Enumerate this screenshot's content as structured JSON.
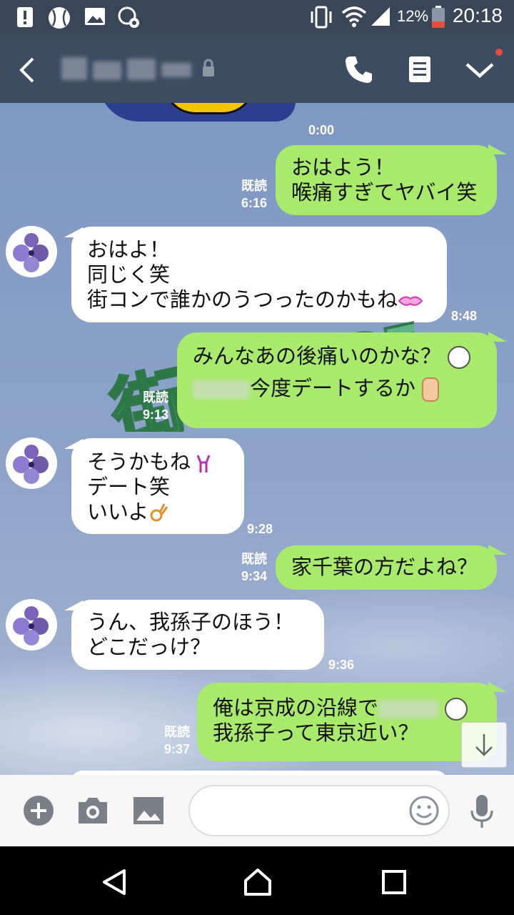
{
  "status_bar": {
    "battery_percent": "12%",
    "time": "20:18",
    "icons": [
      "alert-icon",
      "baseball-icon",
      "image-icon",
      "settings-sync-icon",
      "vibrate-icon",
      "wifi-icon",
      "signal-icon",
      "battery-icon"
    ]
  },
  "header": {
    "icons": [
      "back-icon",
      "lock-icon",
      "phone-icon",
      "notes-icon",
      "chevron-down-icon"
    ],
    "notification_color": "#e74c3c"
  },
  "chat": {
    "top_time": "0:00",
    "messages": [
      {
        "side": "me",
        "lines": [
          "おはよう！",
          "喉痛すぎてヤバイ笑"
        ],
        "read": "既読",
        "time": "6:16"
      },
      {
        "side": "them",
        "lines": [
          "おはよ！",
          "同じく笑",
          "街コンで誰かのうつったのかもね"
        ],
        "time": "8:48"
      },
      {
        "side": "me",
        "lines": [
          "みんなあの後痛いのかな？",
          "今度デートするか"
        ],
        "read": "既読",
        "time": "9:13"
      },
      {
        "side": "them",
        "lines": [
          "そうかもね",
          "デート笑",
          "いいよ"
        ],
        "time": "9:28"
      },
      {
        "side": "me",
        "lines": [
          "家千葉の方だよね？"
        ],
        "read": "既読",
        "time": "9:34"
      },
      {
        "side": "them",
        "lines": [
          "うん、我孫子のほう！",
          "どこだっけ？"
        ],
        "time": "9:36"
      },
      {
        "side": "me",
        "lines": [
          "俺は京成の沿線で",
          "我孫子って東京近い？"
        ],
        "read": "既読",
        "time": "9:37"
      }
    ],
    "watermark": "街コンCEO"
  },
  "input_bar": {
    "icons": [
      "add-icon",
      "camera-icon",
      "image-icon",
      "emoji-icon",
      "mic-icon"
    ]
  },
  "nav_bar": {
    "icons": [
      "nav-back-icon",
      "nav-home-icon",
      "nav-recents-icon"
    ]
  },
  "colors": {
    "header_bg": "#3d4d61",
    "my_bubble": "#a9e96b",
    "their_bubble": "#ffffff",
    "chat_bg": "#8ea4c9"
  }
}
